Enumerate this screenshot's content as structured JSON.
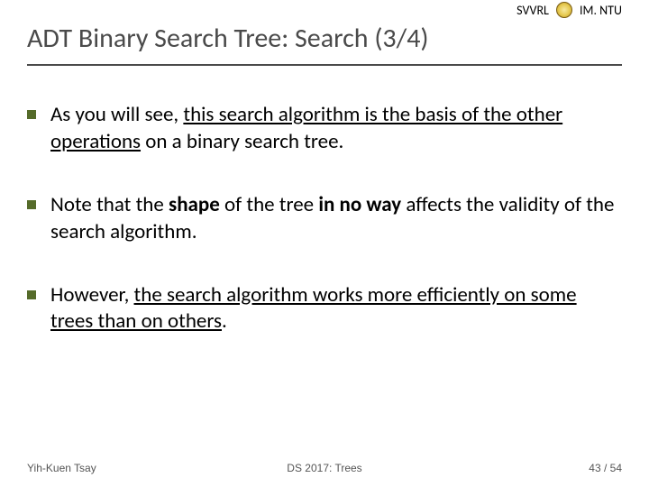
{
  "header": {
    "org_left": "SVVRL",
    "org_right": "IM. NTU",
    "title": "ADT Binary Search Tree: Search (3/4)"
  },
  "bullets": [
    {
      "plain1": "As you will see, ",
      "underlined": "this search algorithm is the basis of the other operations",
      "plain2": " on a binary search tree."
    },
    {
      "plain1": "Note that the ",
      "bold1": "shape",
      "plain2": " of the tree ",
      "bold2": "in no way",
      "plain3": " affects the validity of the search algorithm."
    },
    {
      "plain1": "However, ",
      "underlined": "the search algorithm works more efficiently on some trees than on others",
      "plain2": "."
    }
  ],
  "footer": {
    "author": "Yih-Kuen Tsay",
    "course": "DS 2017: Trees",
    "page_current": "43",
    "page_sep": " / ",
    "page_total": "54"
  }
}
